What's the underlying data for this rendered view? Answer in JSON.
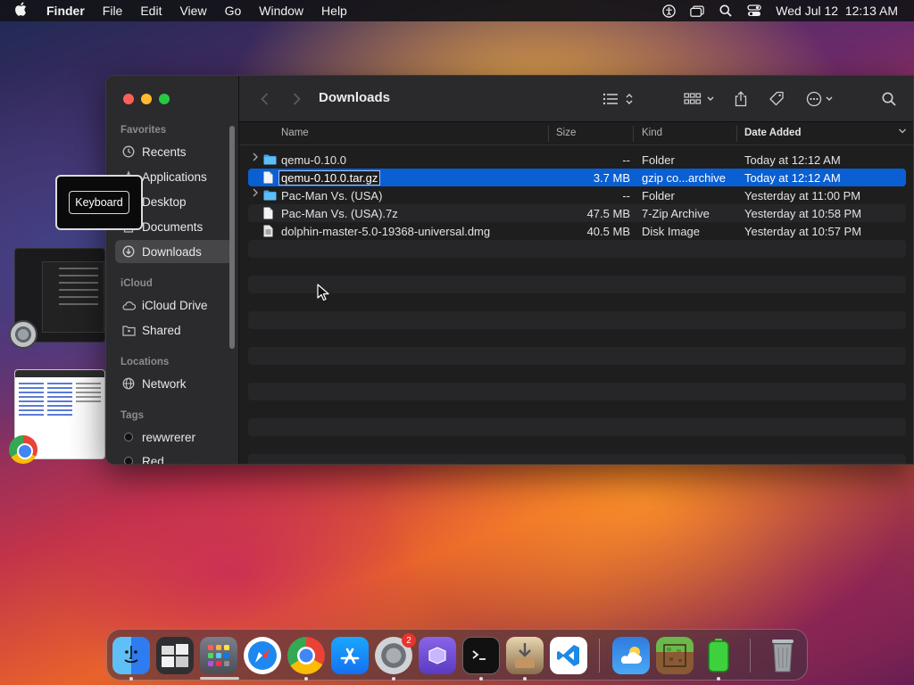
{
  "menubar": {
    "app": "Finder",
    "items": [
      "File",
      "Edit",
      "View",
      "Go",
      "Window",
      "Help"
    ],
    "clock": "Wed Jul 12  12:13 AM"
  },
  "tooltip": {
    "label": "Keyboard"
  },
  "finder": {
    "title": "Downloads",
    "sidebar": {
      "favorites_header": "Favorites",
      "favorites": [
        "Recents",
        "Applications",
        "Desktop",
        "Documents",
        "Downloads"
      ],
      "icloud_header": "iCloud",
      "icloud": [
        "iCloud Drive",
        "Shared"
      ],
      "locations_header": "Locations",
      "locations": [
        "Network"
      ],
      "tags_header": "Tags",
      "tags": [
        "rewwrerer",
        "Red"
      ]
    },
    "columns": {
      "name": "Name",
      "size": "Size",
      "kind": "Kind",
      "date": "Date Added"
    },
    "rows": [
      {
        "name": "qemu-0.10.0",
        "size": "--",
        "kind": "Folder",
        "date": "Today at 12:12 AM",
        "type": "folder"
      },
      {
        "name": "qemu-0.10.0.tar.gz",
        "size": "3.7 MB",
        "kind": "gzip co...archive",
        "date": "Today at 12:12 AM",
        "type": "file"
      },
      {
        "name": "Pac-Man Vs. (USA)",
        "size": "--",
        "kind": "Folder",
        "date": "Yesterday at 11:00 PM",
        "type": "folder"
      },
      {
        "name": "Pac-Man Vs. (USA).7z",
        "size": "47.5 MB",
        "kind": "7-Zip Archive",
        "date": "Yesterday at 10:58 PM",
        "type": "file"
      },
      {
        "name": "dolphin-master-5.0-19368-universal.dmg",
        "size": "40.5 MB",
        "kind": "Disk Image",
        "date": "Yesterday at 10:57 PM",
        "type": "disk"
      }
    ]
  },
  "dock": {
    "settings_badge": "2",
    "apps": [
      "finder-icon",
      "document-stack-icon",
      "launchpad-icon",
      "safari-icon",
      "chrome-icon",
      "app-store-icon",
      "system-settings-icon",
      "utm-icon",
      "terminal-icon",
      "installer-icon",
      "vscode-icon",
      "weather-icon",
      "minecraft-icon",
      "battery-icon",
      "trash-icon"
    ]
  },
  "colors": {
    "selection": "#0a5fd3",
    "sidebar": "#2b2a2d",
    "window": "#1e1e1e"
  }
}
